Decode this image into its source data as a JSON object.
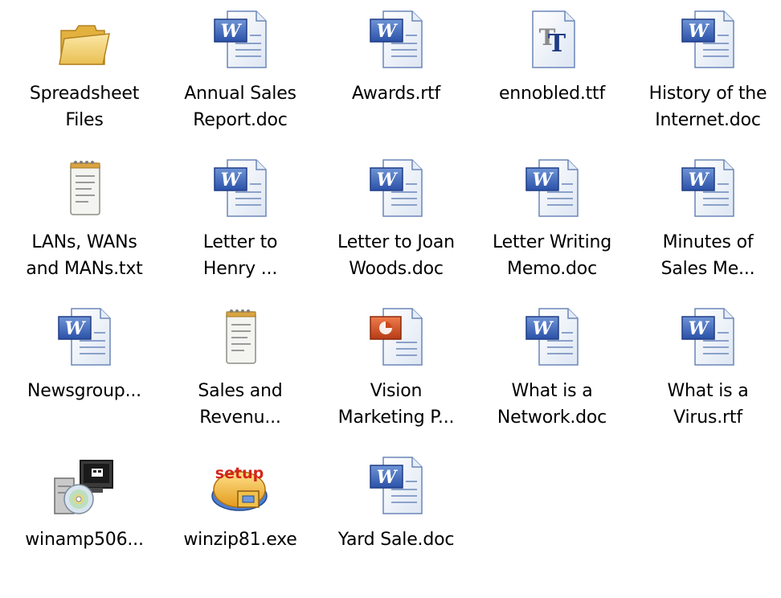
{
  "desktop": {
    "items": [
      {
        "label": "Spreadsheet\nFiles",
        "icon": "folder-icon"
      },
      {
        "label": "Annual Sales\nReport.doc",
        "icon": "word-document-icon"
      },
      {
        "label": "Awards.rtf",
        "icon": "word-document-icon"
      },
      {
        "label": "ennobled.ttf",
        "icon": "truetype-font-icon"
      },
      {
        "label": "History of the\nInternet.doc",
        "icon": "word-document-icon"
      },
      {
        "label": "LANs, WANs\nand MANs.txt",
        "icon": "text-file-icon"
      },
      {
        "label": "Letter to\nHenry ...",
        "icon": "word-document-icon"
      },
      {
        "label": "Letter to Joan\nWoods.doc",
        "icon": "word-document-icon"
      },
      {
        "label": "Letter Writing\nMemo.doc",
        "icon": "word-document-icon"
      },
      {
        "label": "Minutes of\nSales Me...",
        "icon": "word-document-icon"
      },
      {
        "label": "Newsgroup...",
        "icon": "word-document-icon"
      },
      {
        "label": "Sales and\nRevenu...",
        "icon": "text-file-icon"
      },
      {
        "label": "Vision\nMarketing P...",
        "icon": "powerpoint-presentation-icon"
      },
      {
        "label": "What is a\nNetwork.doc",
        "icon": "word-document-icon"
      },
      {
        "label": "What is a\nVirus.rtf",
        "icon": "word-document-icon"
      },
      {
        "label": "winamp506...",
        "icon": "installer-icon"
      },
      {
        "label": "winzip81.exe",
        "icon": "winzip-setup-icon"
      },
      {
        "label": "Yard Sale.doc",
        "icon": "word-document-icon"
      }
    ]
  }
}
